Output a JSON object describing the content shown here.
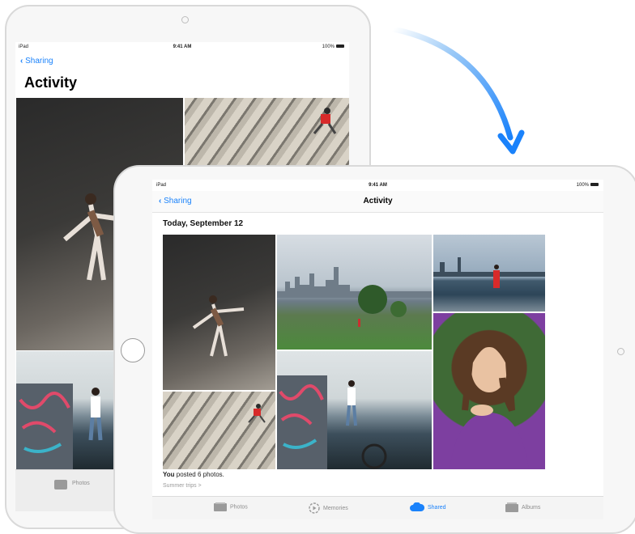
{
  "portrait_ipad": {
    "status": {
      "device": "iPad",
      "time": "9:41 AM",
      "battery": "100%"
    },
    "back_label": "Sharing",
    "title": "Activity",
    "tab_label": "Photos"
  },
  "landscape_ipad": {
    "status": {
      "device": "iPad",
      "time": "9:41 AM",
      "battery": "100%"
    },
    "back_label": "Sharing",
    "title": "Activity",
    "date_header": "Today, September 12",
    "caption_user": "You",
    "caption_text": " posted 6 photos.",
    "album_link": "Summer trips >",
    "tabs": [
      {
        "label": "Photos",
        "icon": "photos-icon"
      },
      {
        "label": "Memories",
        "icon": "memories-icon"
      },
      {
        "label": "Shared",
        "icon": "cloud-icon",
        "active": true
      },
      {
        "label": "Albums",
        "icon": "albums-icon"
      }
    ]
  },
  "colors": {
    "accent": "#1a82fb",
    "arrow": "#2f8ff5"
  }
}
